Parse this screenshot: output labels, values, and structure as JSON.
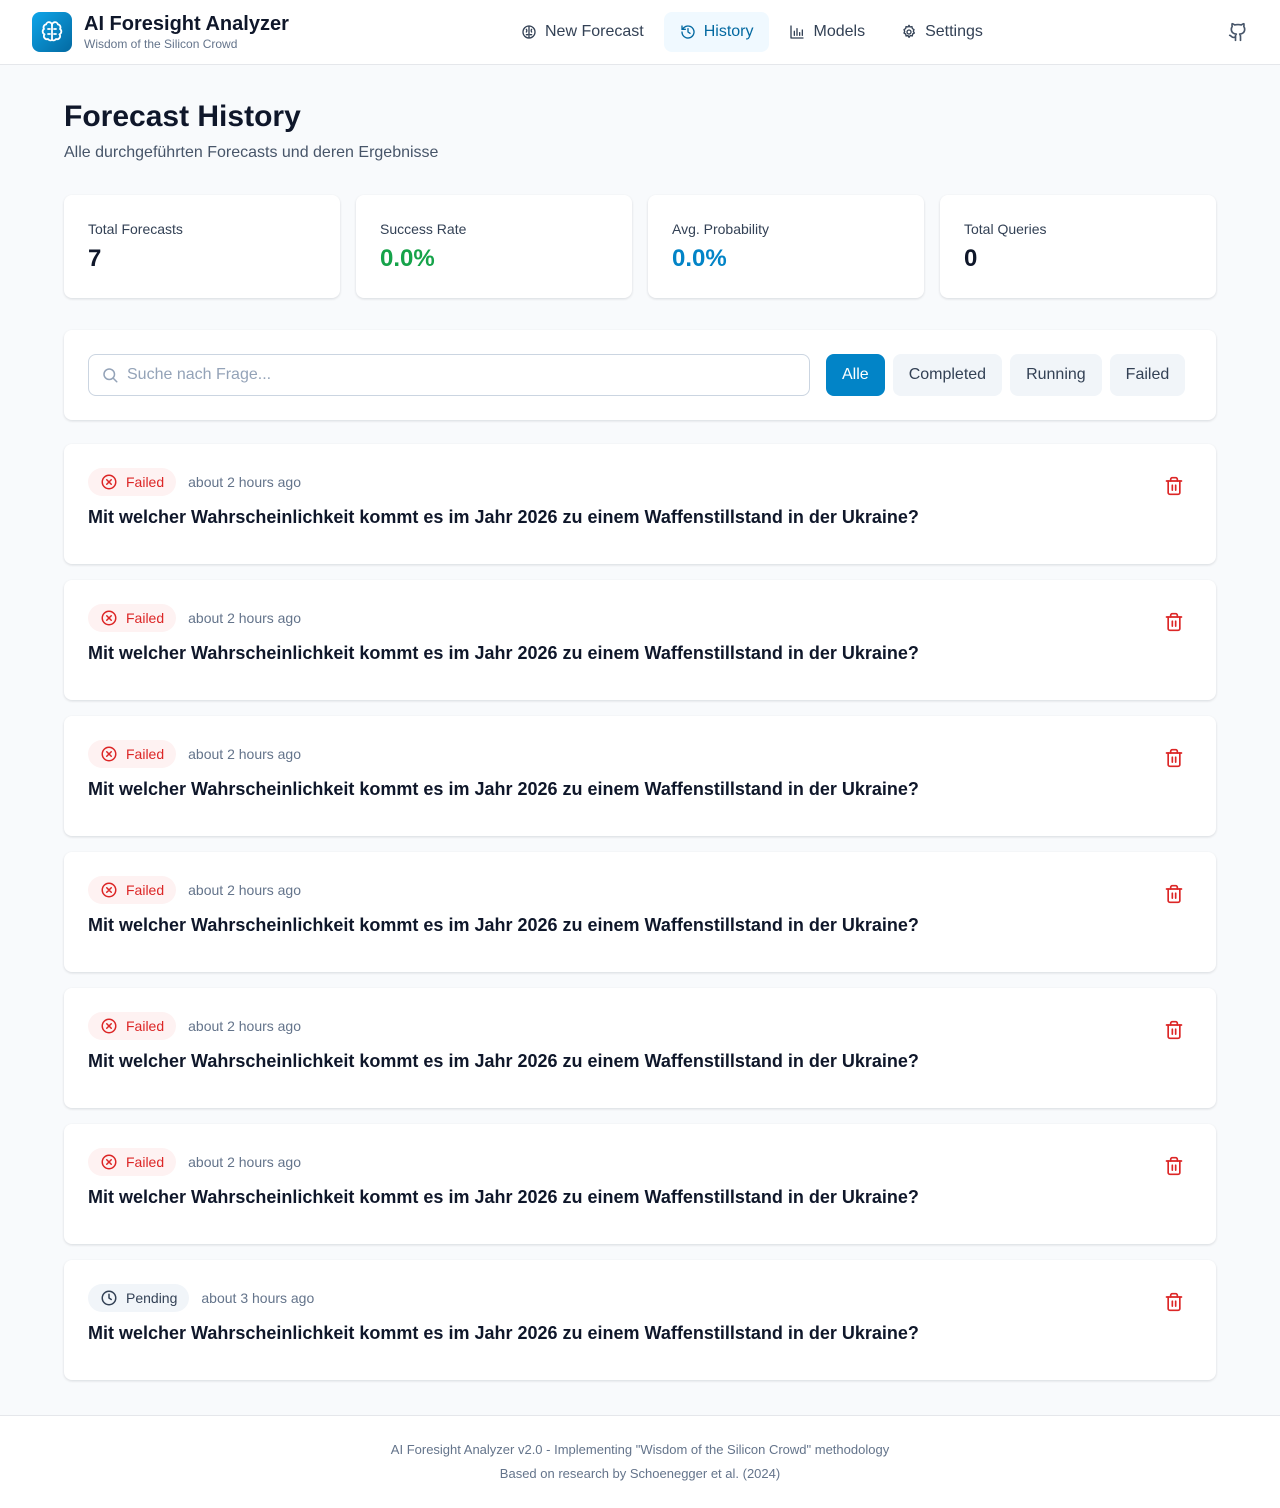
{
  "app": {
    "title": "AI Foresight Analyzer",
    "subtitle": "Wisdom of the Silicon Crowd",
    "logo_icon": "brain-icon"
  },
  "nav": [
    {
      "label": "New Forecast",
      "icon": "brain-icon",
      "active": false
    },
    {
      "label": "History",
      "icon": "history-icon",
      "active": true
    },
    {
      "label": "Models",
      "icon": "bar-chart-icon",
      "active": false
    },
    {
      "label": "Settings",
      "icon": "gear-icon",
      "active": false
    }
  ],
  "header_right": {
    "icon": "github-icon"
  },
  "page": {
    "title": "Forecast History",
    "subtitle": "Alle durchgeführten Forecasts und deren Ergebnisse"
  },
  "stats": [
    {
      "label": "Total Forecasts",
      "value": "7",
      "color": "#0f172a"
    },
    {
      "label": "Success Rate",
      "value": "0.0%",
      "color": "#16a34a"
    },
    {
      "label": "Avg. Probability",
      "value": "0.0%",
      "color": "#0284c7"
    },
    {
      "label": "Total Queries",
      "value": "0",
      "color": "#0f172a"
    }
  ],
  "search": {
    "placeholder": "Suche nach Frage...",
    "value": ""
  },
  "filters": [
    {
      "label": "Alle",
      "active": true
    },
    {
      "label": "Completed",
      "active": false
    },
    {
      "label": "Running",
      "active": false
    },
    {
      "label": "Failed",
      "active": false
    }
  ],
  "forecasts": [
    {
      "status": "Failed",
      "time": "about 2 hours ago",
      "question": "Mit welcher Wahrscheinlichkeit kommt es im Jahr 2026 zu einem Waffenstillstand in der Ukraine?"
    },
    {
      "status": "Failed",
      "time": "about 2 hours ago",
      "question": "Mit welcher Wahrscheinlichkeit kommt es im Jahr 2026 zu einem Waffenstillstand in der Ukraine?"
    },
    {
      "status": "Failed",
      "time": "about 2 hours ago",
      "question": "Mit welcher Wahrscheinlichkeit kommt es im Jahr 2026 zu einem Waffenstillstand in der Ukraine?"
    },
    {
      "status": "Failed",
      "time": "about 2 hours ago",
      "question": "Mit welcher Wahrscheinlichkeit kommt es im Jahr 2026 zu einem Waffenstillstand in der Ukraine?"
    },
    {
      "status": "Failed",
      "time": "about 2 hours ago",
      "question": "Mit welcher Wahrscheinlichkeit kommt es im Jahr 2026 zu einem Waffenstillstand in der Ukraine?"
    },
    {
      "status": "Failed",
      "time": "about 2 hours ago",
      "question": "Mit welcher Wahrscheinlichkeit kommt es im Jahr 2026 zu einem Waffenstillstand in der Ukraine?"
    },
    {
      "status": "Pending",
      "time": "about 3 hours ago",
      "question": "Mit welcher Wahrscheinlichkeit kommt es im Jahr 2026 zu einem Waffenstillstand in der Ukraine?"
    }
  ],
  "footer": {
    "line1": "AI Foresight Analyzer v2.0 - Implementing \"Wisdom of the Silicon Crowd\" methodology",
    "line2": "Based on research by Schoenegger et al. (2024)"
  },
  "colors": {
    "accent": "#0284c7",
    "failed": "#dc2626",
    "pending": "#334155"
  }
}
